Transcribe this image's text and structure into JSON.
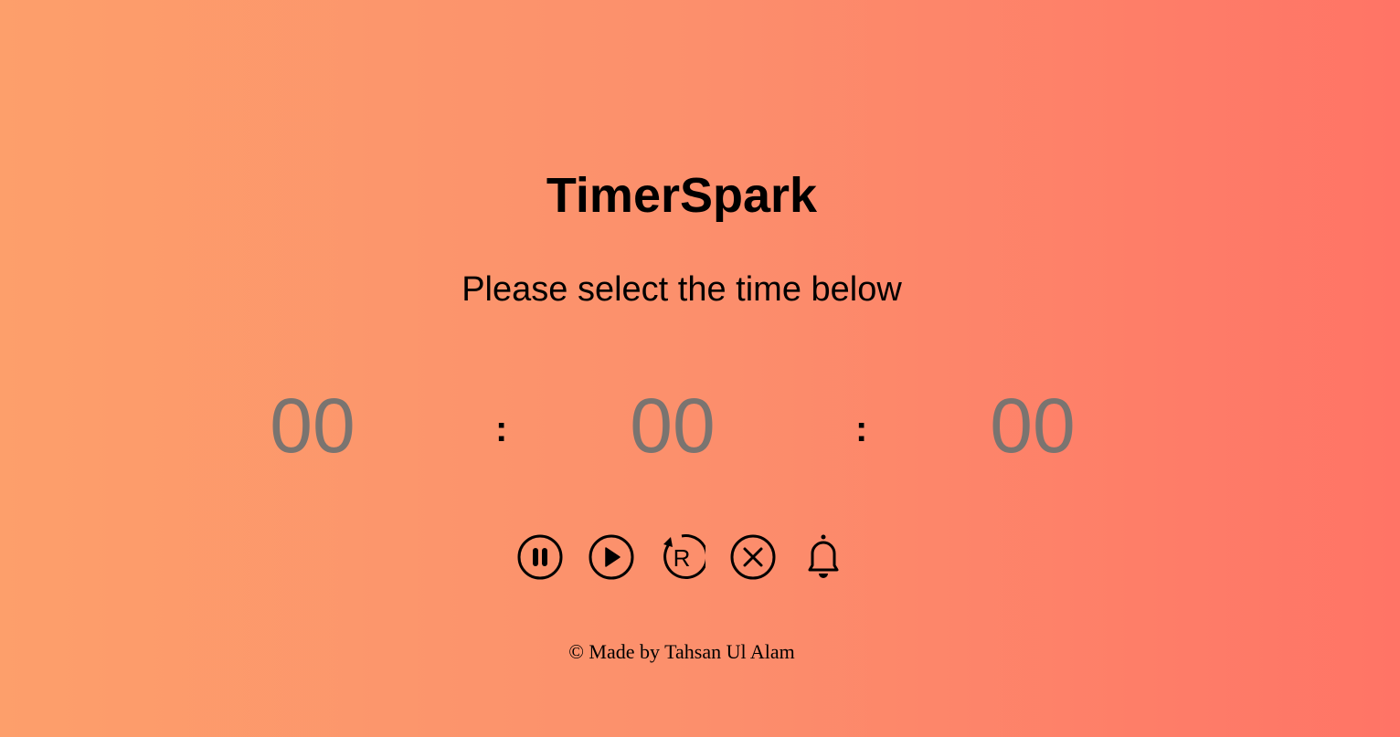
{
  "app": {
    "title": "TimerSpark",
    "subtitle": "Please select the time below"
  },
  "timer": {
    "hours_placeholder": "00",
    "minutes_placeholder": "00",
    "seconds_placeholder": "00",
    "separator": ":"
  },
  "controls": [
    {
      "name": "pause",
      "icon": "pause-circle-icon"
    },
    {
      "name": "play",
      "icon": "play-circle-icon"
    },
    {
      "name": "reset",
      "icon": "reset-circle-icon"
    },
    {
      "name": "stop",
      "icon": "close-circle-icon"
    },
    {
      "name": "alarm",
      "icon": "bell-icon"
    }
  ],
  "footer": {
    "text": "© Made by Tahsan Ul Alam"
  },
  "colors": {
    "background_start": "#fd9f6b",
    "background_end": "#ff7466",
    "digit_color": "#7a7470"
  }
}
